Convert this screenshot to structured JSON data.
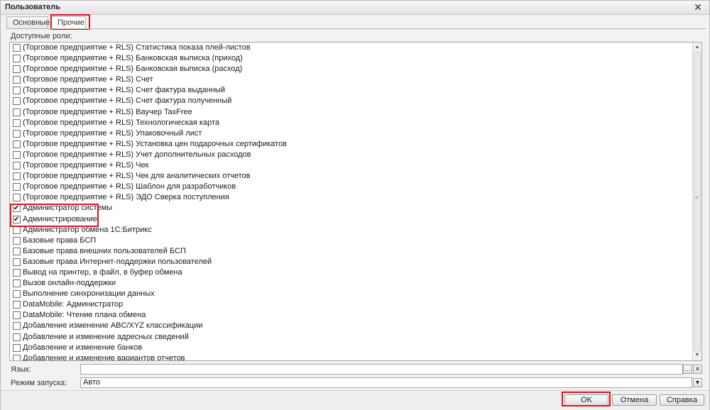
{
  "window": {
    "title": "Пользователь",
    "close_glyph": "✕"
  },
  "tabs": [
    {
      "label": "Основные"
    },
    {
      "label": "Прочие"
    }
  ],
  "available_roles_label": "Доступные роли:",
  "roles": [
    {
      "label": "(Торговое предприятие + RLS) Статистика показа плей-листов",
      "checked": false
    },
    {
      "label": "(Торговое предприятие + RLS) Банковская выписка (приход)",
      "checked": false
    },
    {
      "label": "(Торговое предприятие + RLS) Банковская выписка (расход)",
      "checked": false
    },
    {
      "label": "(Торговое предприятие + RLS) Счет",
      "checked": false
    },
    {
      "label": "(Торговое предприятие + RLS) Счет фактура выданный",
      "checked": false
    },
    {
      "label": "(Торговое предприятие + RLS) Счет фактура полученный",
      "checked": false
    },
    {
      "label": "(Торговое предприятие + RLS) Ваучер TaxFree",
      "checked": false
    },
    {
      "label": "(Торговое предприятие + RLS) Технологическая карта",
      "checked": false
    },
    {
      "label": "(Торговое предприятие + RLS) Упаковочный лист",
      "checked": false
    },
    {
      "label": "(Торговое предприятие + RLS) Установка цен подарочных сертификатов",
      "checked": false
    },
    {
      "label": "(Торговое предприятие + RLS) Учет дополнительных расходов",
      "checked": false
    },
    {
      "label": "(Торговое предприятие + RLS) Чек",
      "checked": false
    },
    {
      "label": "(Торговое предприятие + RLS) Чек для аналитических отчетов",
      "checked": false
    },
    {
      "label": "(Торговое предприятие + RLS) Шаблон для разработчиков",
      "checked": false
    },
    {
      "label": "(Торговое предприятие + RLS) ЭДО Сверка поступления",
      "checked": false
    },
    {
      "label": "Администратор системы",
      "checked": true
    },
    {
      "label": "Администрирование",
      "checked": true
    },
    {
      "label": "Администратор обмена 1С:Битрикс",
      "checked": false
    },
    {
      "label": "Базовые права БСП",
      "checked": false
    },
    {
      "label": "Базовые права внешних пользователей БСП",
      "checked": false
    },
    {
      "label": "Базовые права Интернет-поддержки пользователей",
      "checked": false
    },
    {
      "label": "Вывод на принтер, в файл, в буфер обмена",
      "checked": false
    },
    {
      "label": "Вызов онлайн-поддержки",
      "checked": false
    },
    {
      "label": "Выполнение синхронизации данных",
      "checked": false
    },
    {
      "label": "DataMobile: Администратор",
      "checked": false
    },
    {
      "label": "DataMobile: Чтение плана обмена",
      "checked": false
    },
    {
      "label": "Добавление изменение ABC/XYZ классификации",
      "checked": false
    },
    {
      "label": "Добавление и изменение адресных сведений",
      "checked": false
    },
    {
      "label": "Добавление и изменение банков",
      "checked": false
    },
    {
      "label": "Добавление и изменение вариантов отчетов",
      "checked": false
    }
  ],
  "language": {
    "label": "Язык:",
    "value": "",
    "button": "..."
  },
  "launch_mode": {
    "label": "Режим запуска:",
    "value": "Авто"
  },
  "buttons": {
    "ok": "OK",
    "cancel": "Отмена",
    "help": "Справка"
  },
  "icons": {
    "check": "check-icon",
    "close": "close-icon"
  },
  "colors": {
    "highlight": "#e0141e"
  }
}
